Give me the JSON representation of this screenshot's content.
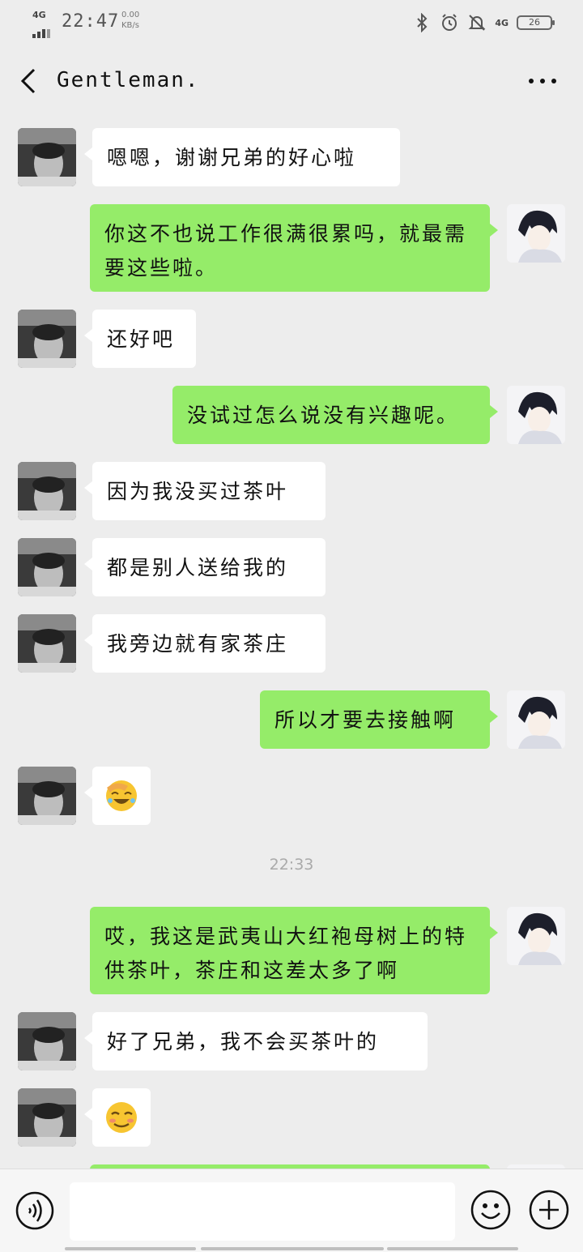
{
  "status_bar": {
    "network": "4G",
    "time": "22:47",
    "speed_value": "0.00",
    "speed_unit": "KB/s",
    "right_network": "4G",
    "battery": "26"
  },
  "header": {
    "title": "Gentleman.",
    "back_icon": "chevron-left-icon",
    "more_icon": "more-dots-icon"
  },
  "messages": [
    {
      "side": "in",
      "text": "嗯嗯，谢谢兄弟的好心啦"
    },
    {
      "side": "out",
      "text": "你这不也说工作很满很累吗，就最需要这些啦。"
    },
    {
      "side": "in",
      "text": "还好吧"
    },
    {
      "side": "out",
      "text": "没试过怎么说没有兴趣呢。"
    },
    {
      "side": "in",
      "text": "因为我没买过茶叶"
    },
    {
      "side": "in",
      "text": "都是别人送给我的"
    },
    {
      "side": "in",
      "text": "我旁边就有家茶庄"
    },
    {
      "side": "out",
      "text": "所以才要去接触啊"
    },
    {
      "side": "in",
      "emoji": "facepalm-laugh-emoji"
    },
    {
      "timestamp": "22:33"
    },
    {
      "side": "out",
      "text": "哎，我这是武夷山大红袍母树上的特供茶叶，茶庄和这差太多了啊"
    },
    {
      "side": "in",
      "text": "好了兄弟，我不会买茶叶的"
    },
    {
      "side": "in",
      "emoji": "shy-smile-emoji"
    }
  ],
  "input_bar": {
    "voice_icon": "voice-icon",
    "input_value": "",
    "emoji_icon": "emoji-icon",
    "plus_icon": "plus-icon"
  },
  "colors": {
    "background": "#ededed",
    "out_bubble": "#95ec69",
    "in_bubble": "#ffffff"
  }
}
